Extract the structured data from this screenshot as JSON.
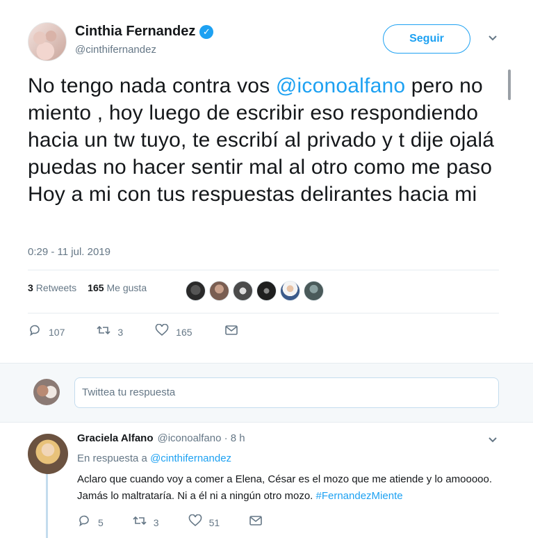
{
  "tweet": {
    "display_name": "Cinthia Fernandez",
    "verified_glyph": "✓",
    "handle": "@cinthifernandez",
    "follow_label": "Seguir",
    "text_before": "No tengo nada contra vos ",
    "mention": "@iconoalfano",
    "text_after": " pero no miento , hoy luego de escribir eso respondiendo hacia un tw tuyo, te escribí al privado y t dije ojalá puedas no hacer sentir mal al otro como me paso Hoy a mi con tus respuestas delirantes hacia mi",
    "timestamp": "0:29 - 11 jul. 2019",
    "retweets_count": "3",
    "retweets_label": "Retweets",
    "likes_count": "165",
    "likes_label": "Me gusta",
    "actions": {
      "reply_count": "107",
      "retweet_count": "3",
      "like_count": "165"
    }
  },
  "reply_box": {
    "placeholder": "Twittea tu respuesta"
  },
  "reply": {
    "display_name": "Graciela Alfano",
    "handle_time": "@iconoalfano · 8 h",
    "in_reply_prefix": "En respuesta a ",
    "in_reply_mention": "@cinthifernandez",
    "text": "Aclaro que cuando voy a comer a Elena, César es el mozo que me atiende y lo amooooo. Jamás lo maltrataría. Ni a él ni a ningún otro mozo. ",
    "hashtag": "#FernandezMiente",
    "actions": {
      "reply_count": "5",
      "retweet_count": "3",
      "like_count": "51"
    }
  },
  "icons": {
    "reply": "reply-icon",
    "retweet": "retweet-icon",
    "like": "heart-icon",
    "message": "message-icon",
    "caret": "chevron-down-icon"
  },
  "colors": {
    "accent": "#1da1f2",
    "muted": "#657786",
    "text": "#14171a"
  }
}
